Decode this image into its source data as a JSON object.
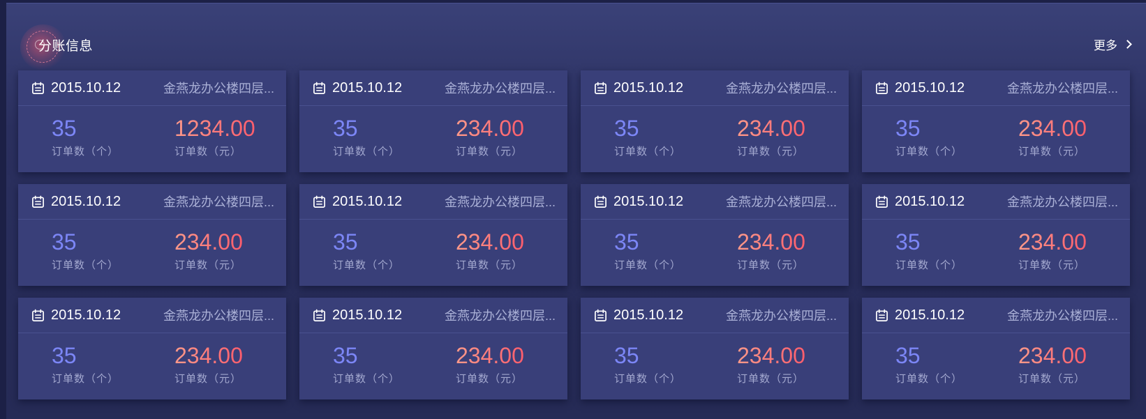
{
  "panel": {
    "title": "分账信息",
    "more_label": "更多"
  },
  "colors": {
    "count_value": "#7c86f6",
    "amount_value_start": "#ff9a8a",
    "amount_value_end": "#ff5d6c",
    "card_bg": "#393f79"
  },
  "icons": {
    "card_date": "calendar-icon",
    "more": "chevron-right-icon",
    "title_decoration": "radar-circle-icon"
  },
  "cards": [
    {
      "date": "2015.10.12",
      "location": "金燕龙办公楼四层...",
      "count": "35",
      "count_label": "订单数（个）",
      "amount": "1234.00",
      "amount_label": "订单数（元）"
    },
    {
      "date": "2015.10.12",
      "location": "金燕龙办公楼四层...",
      "count": "35",
      "count_label": "订单数（个）",
      "amount": "234.00",
      "amount_label": "订单数（元）"
    },
    {
      "date": "2015.10.12",
      "location": "金燕龙办公楼四层...",
      "count": "35",
      "count_label": "订单数（个）",
      "amount": "234.00",
      "amount_label": "订单数（元）"
    },
    {
      "date": "2015.10.12",
      "location": "金燕龙办公楼四层...",
      "count": "35",
      "count_label": "订单数（个）",
      "amount": "234.00",
      "amount_label": "订单数（元）"
    },
    {
      "date": "2015.10.12",
      "location": "金燕龙办公楼四层...",
      "count": "35",
      "count_label": "订单数（个）",
      "amount": "234.00",
      "amount_label": "订单数（元）"
    },
    {
      "date": "2015.10.12",
      "location": "金燕龙办公楼四层...",
      "count": "35",
      "count_label": "订单数（个）",
      "amount": "234.00",
      "amount_label": "订单数（元）"
    },
    {
      "date": "2015.10.12",
      "location": "金燕龙办公楼四层...",
      "count": "35",
      "count_label": "订单数（个）",
      "amount": "234.00",
      "amount_label": "订单数（元）"
    },
    {
      "date": "2015.10.12",
      "location": "金燕龙办公楼四层...",
      "count": "35",
      "count_label": "订单数（个）",
      "amount": "234.00",
      "amount_label": "订单数（元）"
    },
    {
      "date": "2015.10.12",
      "location": "金燕龙办公楼四层...",
      "count": "35",
      "count_label": "订单数（个）",
      "amount": "234.00",
      "amount_label": "订单数（元）"
    },
    {
      "date": "2015.10.12",
      "location": "金燕龙办公楼四层...",
      "count": "35",
      "count_label": "订单数（个）",
      "amount": "234.00",
      "amount_label": "订单数（元）"
    },
    {
      "date": "2015.10.12",
      "location": "金燕龙办公楼四层...",
      "count": "35",
      "count_label": "订单数（个）",
      "amount": "234.00",
      "amount_label": "订单数（元）"
    },
    {
      "date": "2015.10.12",
      "location": "金燕龙办公楼四层...",
      "count": "35",
      "count_label": "订单数（个）",
      "amount": "234.00",
      "amount_label": "订单数（元）"
    }
  ]
}
